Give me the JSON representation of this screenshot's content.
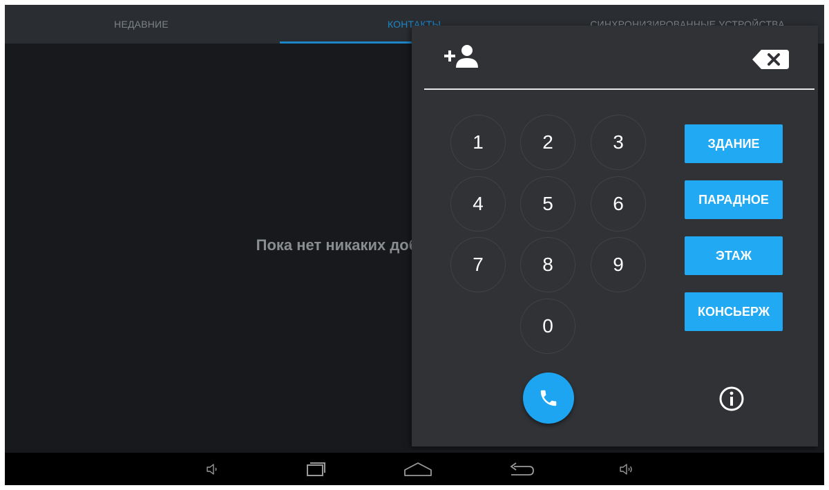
{
  "tabs": {
    "recent": "НЕДАВНИЕ",
    "contacts": "КОНТАКТЫ",
    "synced": "СИНХРОНИЗИРОВАННЫЕ УСТРОЙСТВА"
  },
  "empty_message": "Пока нет никаких добавленных контактов",
  "dialpad": {
    "number": "",
    "keys": [
      "1",
      "2",
      "3",
      "4",
      "5",
      "6",
      "7",
      "8",
      "9",
      "0"
    ],
    "functions": {
      "building": "ЗДАНИЕ",
      "entrance": "ПАРАДНОЕ",
      "floor": "ЭТАЖ",
      "concierge": "КОНСЬЕРЖ"
    },
    "icons": {
      "add_contact": "add-contact-icon",
      "backspace": "backspace-icon",
      "call": "phone-icon",
      "info": "info-icon"
    }
  },
  "navbar": {
    "icons": [
      "volume-down-icon",
      "recent-apps-icon",
      "home-icon",
      "back-icon",
      "volume-up-icon"
    ]
  },
  "colors": {
    "accent": "#22a9f3",
    "tab_active": "#1d86c8",
    "panel": "#303236",
    "background": "#17191c"
  }
}
